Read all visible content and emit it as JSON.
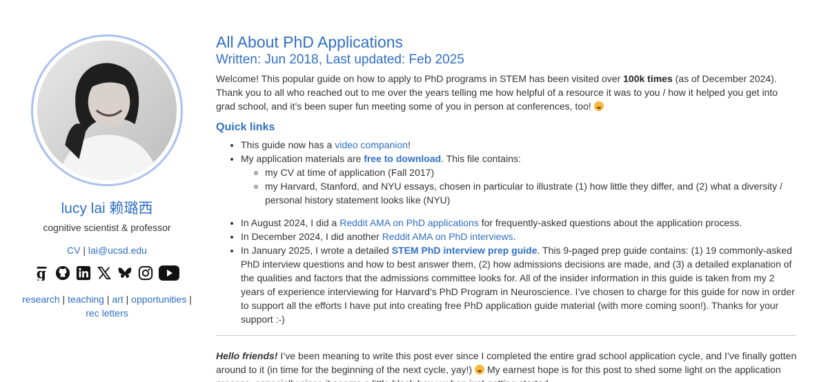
{
  "sidebar": {
    "name": "lucy lai 赖璐西",
    "tagline": "cognitive scientist & professor",
    "contact": {
      "cv": "CV",
      "sep": " | ",
      "email": "lai@ucsd.edu"
    },
    "social_icons": [
      "google-scholar-icon",
      "github-icon",
      "linkedin-icon",
      "x-icon",
      "bluesky-icon",
      "instagram-icon",
      "youtube-icon"
    ],
    "nav": {
      "research": "research",
      "teaching": "teaching",
      "art": "art",
      "opportunities": "opportunities",
      "rec_letters": "rec letters",
      "sep": " | ",
      "trail": " |"
    }
  },
  "main": {
    "title": "All About PhD Applications",
    "subtitle": "Written: Jun 2018, Last updated: Feb 2025",
    "welcome": {
      "t1": "Welcome! This popular guide on how to apply to PhD programs in STEM has been visited over ",
      "bold": "100k times",
      "t2": " (as of December 2024). Thank you to all who reached out to me over the years telling me how helpful of a resource it was to you / how it helped you get into grad school, and it’s been super fun meeting some of you in person at conferences, too! "
    },
    "quick_links_heading": "Quick links",
    "quick_links": {
      "l1_pre": "This guide now has a ",
      "l1_link": "video companion",
      "l1_post": "!",
      "l2_pre": "My application materials are ",
      "l2_link": "free to download",
      "l2_post": ". This file contains:",
      "l2_sub1": "my CV at time of application (Fall 2017)",
      "l2_sub2": "my Harvard, Stanford, and NYU essays, chosen in particular to illustrate (1) how little they differ, and (2) what a diversity / personal history statement looks like (NYU)",
      "l3_pre": "In August 2024, I did a ",
      "l3_link": "Reddit AMA on PhD applications",
      "l3_post": " for frequently-asked questions about the application process.",
      "l4_pre": "In December 2024, I did another ",
      "l4_link": "Reddit AMA on PhD interviews",
      "l4_post": ".",
      "l5_pre": "In January 2025, I wrote a detailed ",
      "l5_link": "STEM PhD interview prep guide",
      "l5_post": ". This 9-paged prep guide contains: (1) 19 commonly-asked PhD interview questions and how to best answer them, (2) how admissions decisions are made, and (3) a detailed explanation of the qualities and factors that the admissions committee looks for. All of the insider information in this guide is taken from my 2 years of experience interviewing for Harvard’s PhD Program in Neuroscience. I’ve chosen to charge for this guide for now in order to support all the efforts I have put into creating free PhD application guide material (with more coming soon!). Thanks for your support :-)"
    },
    "hello": {
      "bold": "Hello friends!",
      "t1": " I’ve been meaning to write this post ever since I completed the entire grad school application cycle, and I’ve finally gotten around to it (in time for the beginning of the next cycle, yay!) ",
      "t2": "  My earnest hope is for this post to shed some light on the application process, especially since it seems a little black box-y when just getting started."
    }
  },
  "colors": {
    "accent": "#2f6fc4",
    "ring": "#a9c1ee",
    "text": "#333333"
  }
}
